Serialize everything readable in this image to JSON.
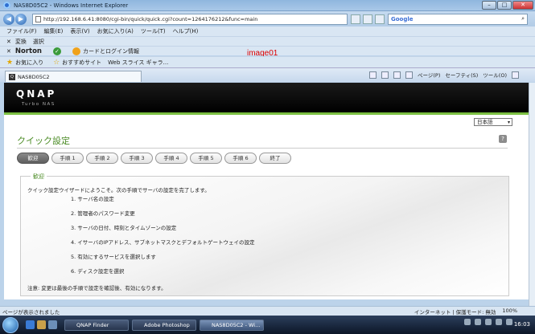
{
  "window": {
    "title": "NAS8D05C2 - Windows Internet Explorer",
    "min": "–",
    "max": "□",
    "close": "✕"
  },
  "address": {
    "url": "http://192.168.6.41:8080/cgi-bin/quick/quick.cgi?count=1264176212&func=main",
    "search_label": "Google",
    "search_glyph": "⌕"
  },
  "nav": {
    "back": "◀",
    "forward": "▶"
  },
  "menu": [
    "ファイル(F)",
    "編集(E)",
    "表示(V)",
    "お気に入り(A)",
    "ツール(T)",
    "ヘルプ(H)"
  ],
  "toolbar1": {
    "close": "✕",
    "convert": "変換",
    "select": "選択"
  },
  "toolbar2": {
    "close": "✕",
    "norton": "Norton",
    "norton_arrow": "·",
    "check": "✓",
    "card": "カードとログイン情報"
  },
  "watermark": "image01",
  "favorites": {
    "label": "お気に入り",
    "suggested": "おすすめサイト",
    "slice": "Web スライス ギャラ..."
  },
  "tab": {
    "title": "NAS8D05C2"
  },
  "command_bar": [
    "ページ(P)",
    "セーフティ(S)",
    "ツール(O)"
  ],
  "qnap": {
    "logo": "QNAP",
    "tagline": "Turbo NAS"
  },
  "lang": "日本語",
  "page": {
    "title": "クイック設定",
    "help": "?"
  },
  "steps": [
    "歓迎",
    "手順 1",
    "手順 2",
    "手順 3",
    "手順 4",
    "手順 5",
    "手順 6",
    "終了"
  ],
  "welcome": {
    "legend": "歓迎",
    "intro": "クイック設定ウイザードにようこそ。次の手順でサーバの設定を完了します。",
    "items": [
      "1. サーバ名の設定",
      "2. 管理者のパスワード変更",
      "3. サーバの日付、時刻とタイムゾーンの設定",
      "4. イサーバのIPアドレス、サブネットマスクとデフォルトゲートウェイの設定",
      "5. 有効にするサービスを選択します",
      "6. ディスク設定を選択"
    ],
    "note": "注意: 変更は最後の手順で設定を確認後、有効になります。"
  },
  "status": {
    "left": "ページが表示されました",
    "zone": "インターネット | 保護モード: 無効",
    "zoom": "100%"
  },
  "taskbar": {
    "items": [
      "QNAP Finder",
      "Adobe Photoshop ...",
      "NAS8D05C2 - Wi..."
    ],
    "clock": "16:03"
  }
}
